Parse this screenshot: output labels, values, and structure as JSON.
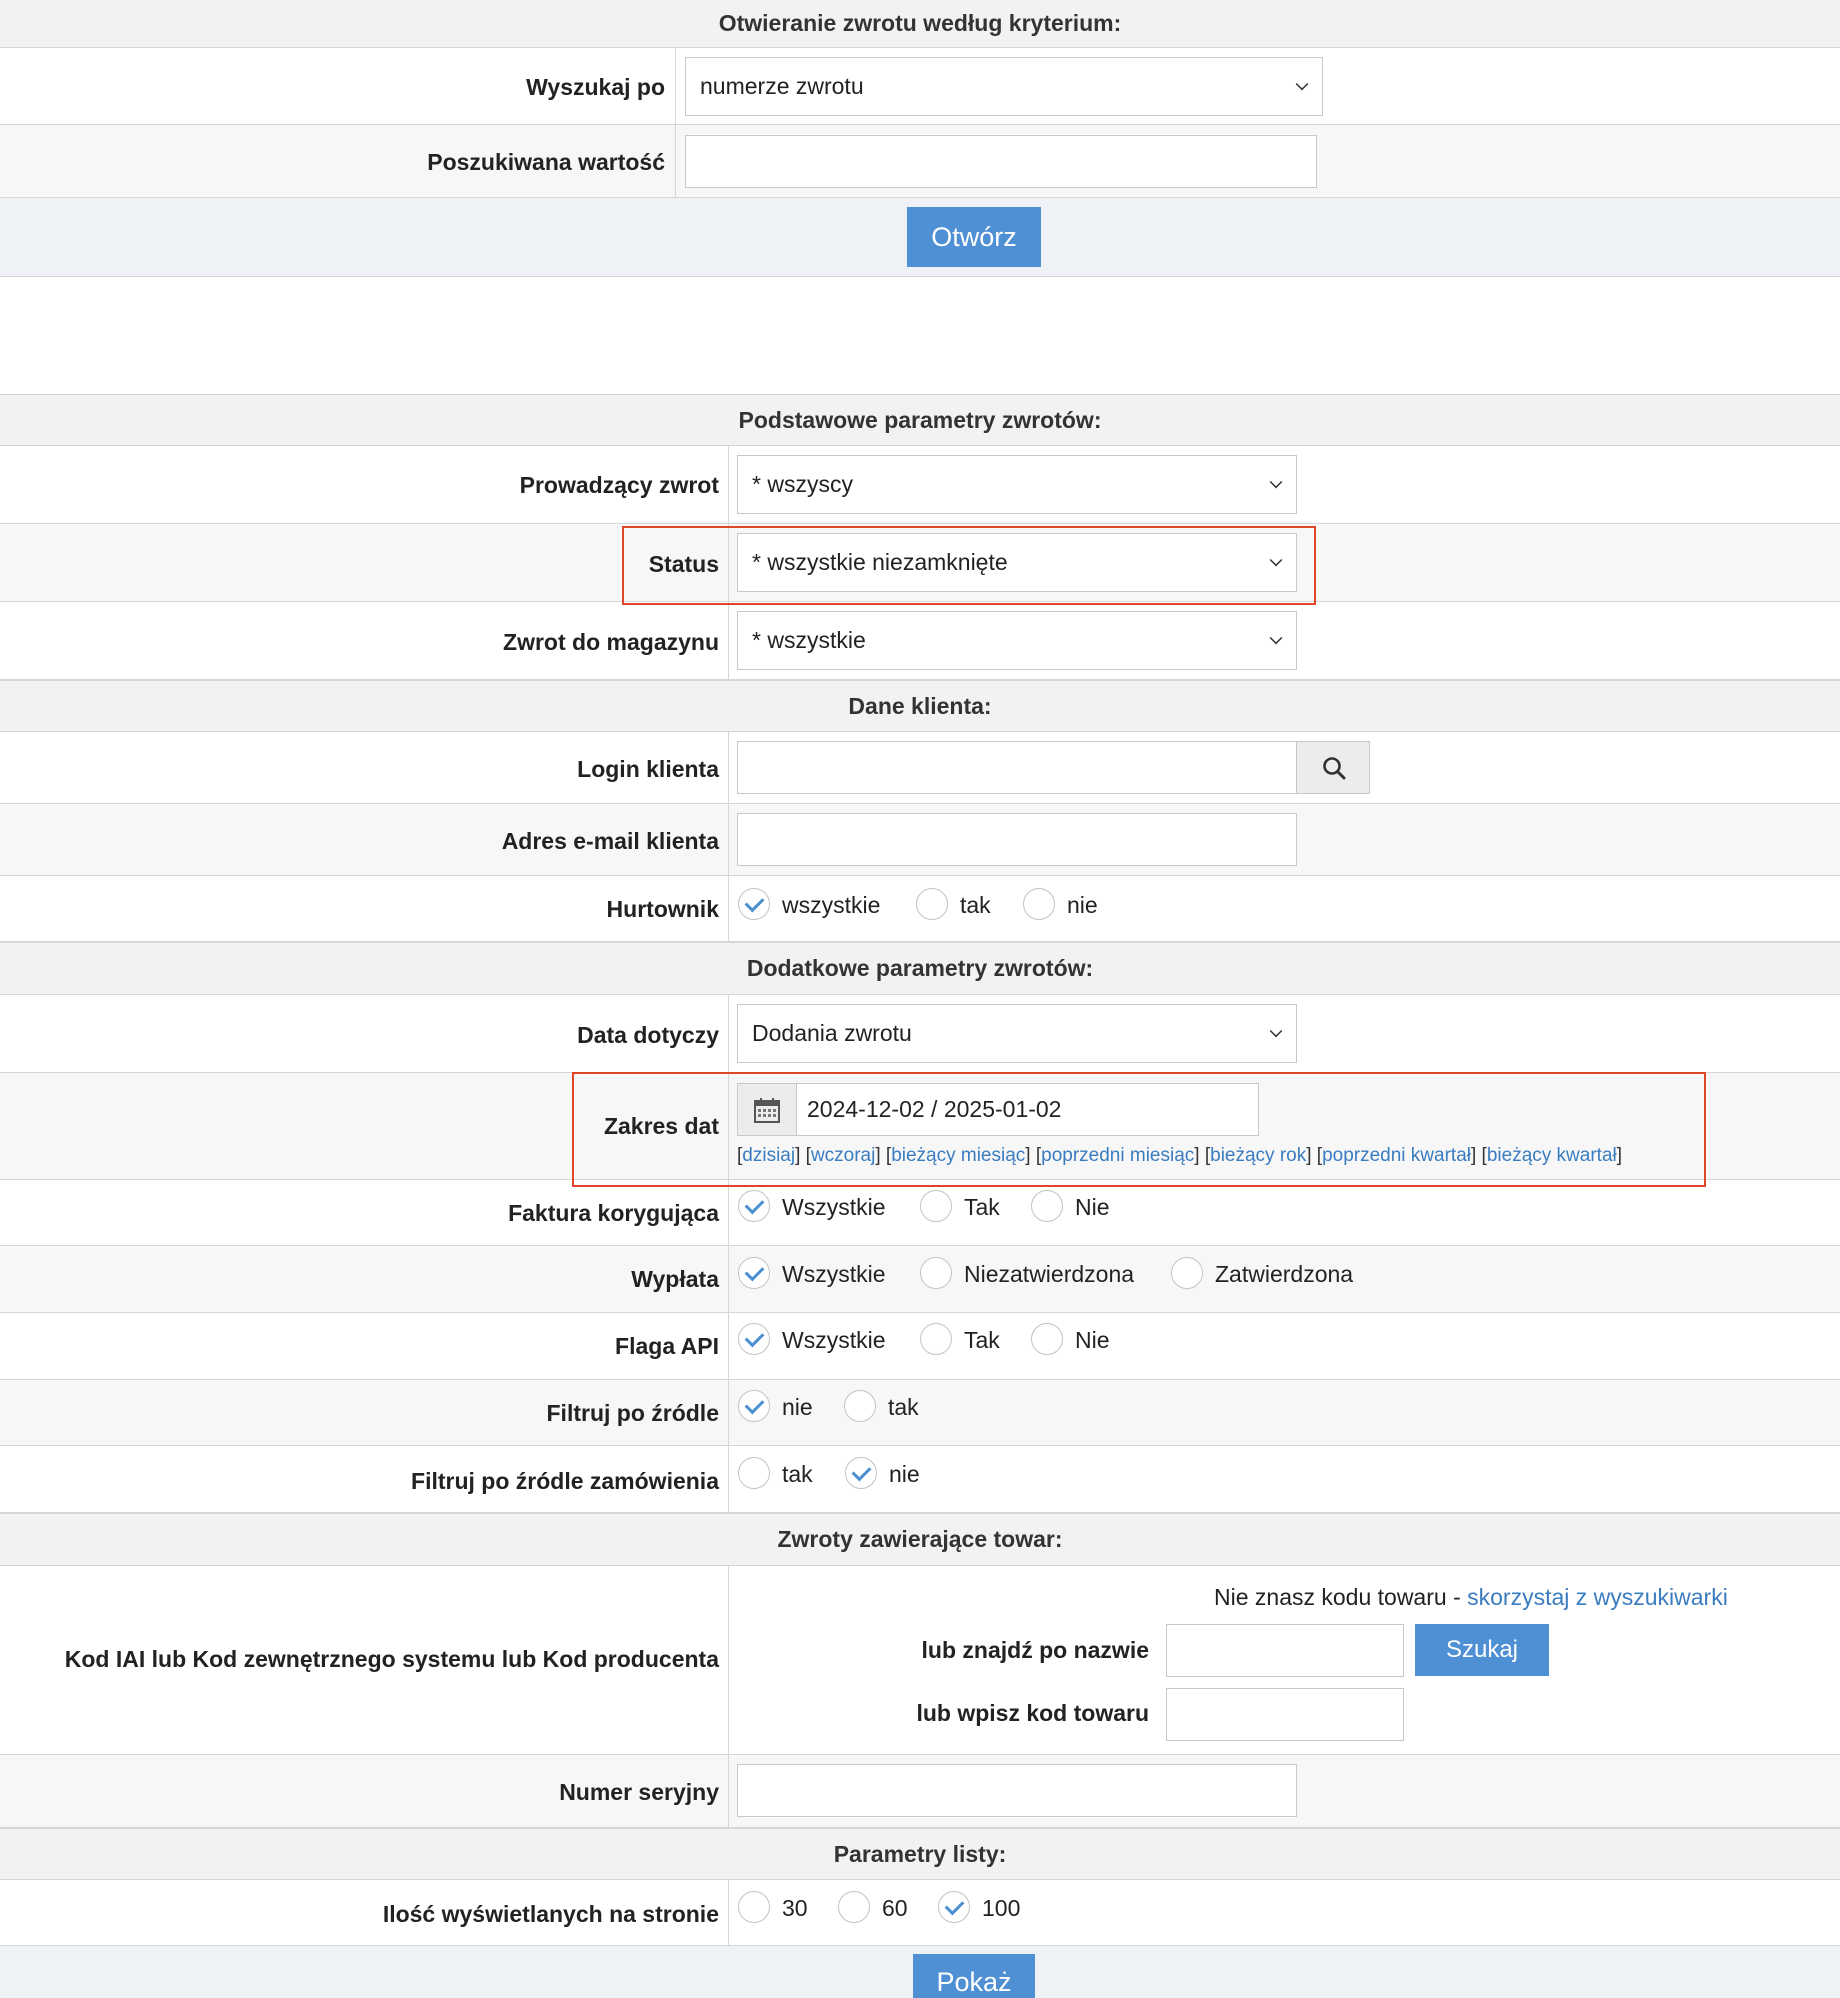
{
  "open_section": {
    "title": "Otwieranie zwrotu według kryterium:",
    "search_by_label": "Wyszukaj po",
    "search_by_value": "numerze zwrotu",
    "value_label": "Poszukiwana wartość",
    "open_button": "Otwórz"
  },
  "basic": {
    "title": "Podstawowe parametry zwrotów:",
    "handler_label": "Prowadzący zwrot",
    "handler_value": "* wszyscy",
    "status_label": "Status",
    "status_value": "* wszystkie niezamknięte",
    "warehouse_label": "Zwrot do magazynu",
    "warehouse_value": "* wszystkie"
  },
  "client": {
    "title": "Dane klienta:",
    "login_label": "Login klienta",
    "email_label": "Adres e-mail klienta",
    "wholesaler_label": "Hurtownik",
    "wholesaler_options": [
      "wszystkie",
      "tak",
      "nie"
    ]
  },
  "additional": {
    "title": "Dodatkowe parametry zwrotów:",
    "date_concerns_label": "Data dotyczy",
    "date_concerns_value": "Dodania zwrotu",
    "date_range_label": "Zakres dat",
    "date_range_value": "2024-12-02 / 2025-01-02",
    "quick_links": [
      "dzisiaj",
      "wczoraj",
      "bieżący miesiąc",
      "poprzedni miesiąc",
      "bieżący rok",
      "poprzedni kwartał",
      "bieżący kwartał"
    ],
    "correction_label": "Faktura korygująca",
    "correction_options": [
      "Wszystkie",
      "Tak",
      "Nie"
    ],
    "payout_label": "Wypłata",
    "payout_options": [
      "Wszystkie",
      "Niezatwierdzona",
      "Zatwierdzona"
    ],
    "api_label": "Flaga API",
    "api_options": [
      "Wszystkie",
      "Tak",
      "Nie"
    ],
    "source_label": "Filtruj po źródle",
    "source_options": [
      "nie",
      "tak"
    ],
    "order_source_label": "Filtruj po źródle zamówienia",
    "order_source_options": [
      "tak",
      "nie"
    ]
  },
  "products": {
    "title": "Zwroty zawierające towar:",
    "code_label": "Kod IAI lub Kod zewnętrznego systemu lub Kod producenta",
    "hint_text": "Nie znasz kodu towaru - ",
    "hint_link": "skorzystaj z wyszukiwarki",
    "find_by_name_label": "lub znajdź po nazwie",
    "search_button": "Szukaj",
    "enter_code_label": "lub wpisz kod towaru",
    "serial_label": "Numer seryjny"
  },
  "list": {
    "title": "Parametry listy:",
    "per_page_label": "Ilość wyświetlanych na stronie",
    "per_page_options": [
      "30",
      "60",
      "100"
    ],
    "show_button": "Pokaż"
  }
}
